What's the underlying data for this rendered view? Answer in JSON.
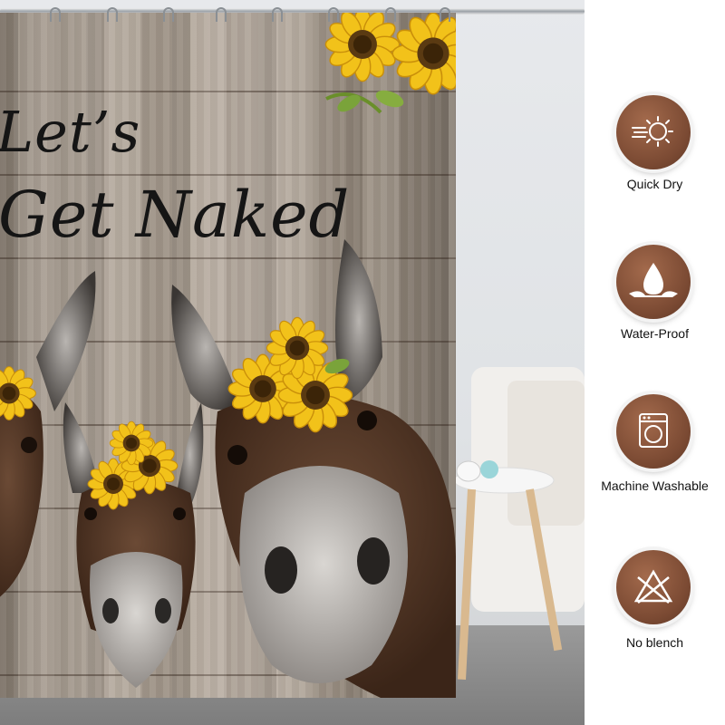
{
  "curtain": {
    "line1": "Let’s",
    "line2": "Get Naked"
  },
  "features": [
    {
      "label": "Quick Dry",
      "icon": "sun-dry-icon"
    },
    {
      "label": "Water-Proof",
      "icon": "water-drop-icon"
    },
    {
      "label": "Machine Washable",
      "icon": "washing-machine-icon"
    },
    {
      "label": "No blench",
      "icon": "no-bleach-icon"
    }
  ],
  "colors": {
    "badge": "#7b4a33",
    "wood": "#a99d90",
    "sunflower": "#f2c21a"
  }
}
